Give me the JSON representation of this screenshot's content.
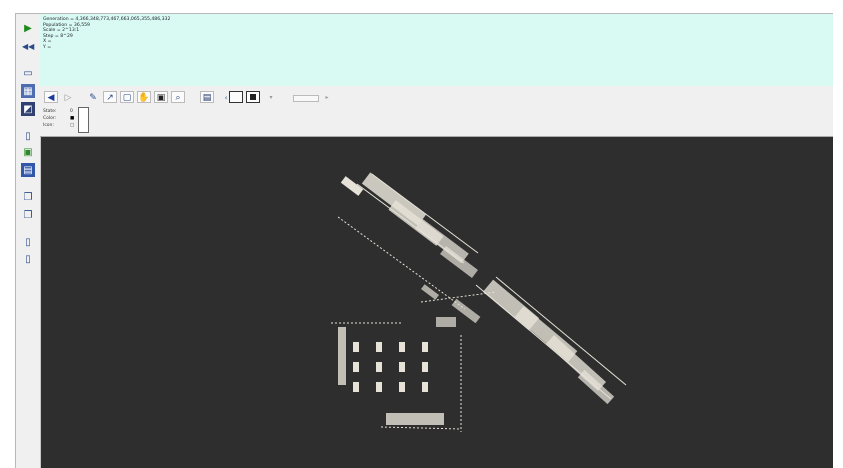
{
  "info": {
    "generation": "Generation = 4,366,348,773,467,663,065,355,486,332",
    "population": "Population = 36,559",
    "scale": "Scale = 2^13:1",
    "step": "Step = 8^29",
    "x": "X =",
    "y": "Y ="
  },
  "sidebar": {
    "icons": [
      "play-icon",
      "rewind-icon",
      "open-folder-icon",
      "grid-icon",
      "image-icon",
      "new-file-icon",
      "save-icon",
      "run-script-icon",
      "copy-icon",
      "paste-icon",
      "info-icon",
      "help-icon"
    ]
  },
  "toolbar": {
    "zoom_mark": "‹",
    "state_label": "State:",
    "state_value": "0",
    "color_label": "Color:",
    "icon_label": "Icon:"
  },
  "colors": {
    "info_bg": "#d8faf2",
    "canvas_bg": "#2d2e2d",
    "cells": "#e9e6dc"
  }
}
